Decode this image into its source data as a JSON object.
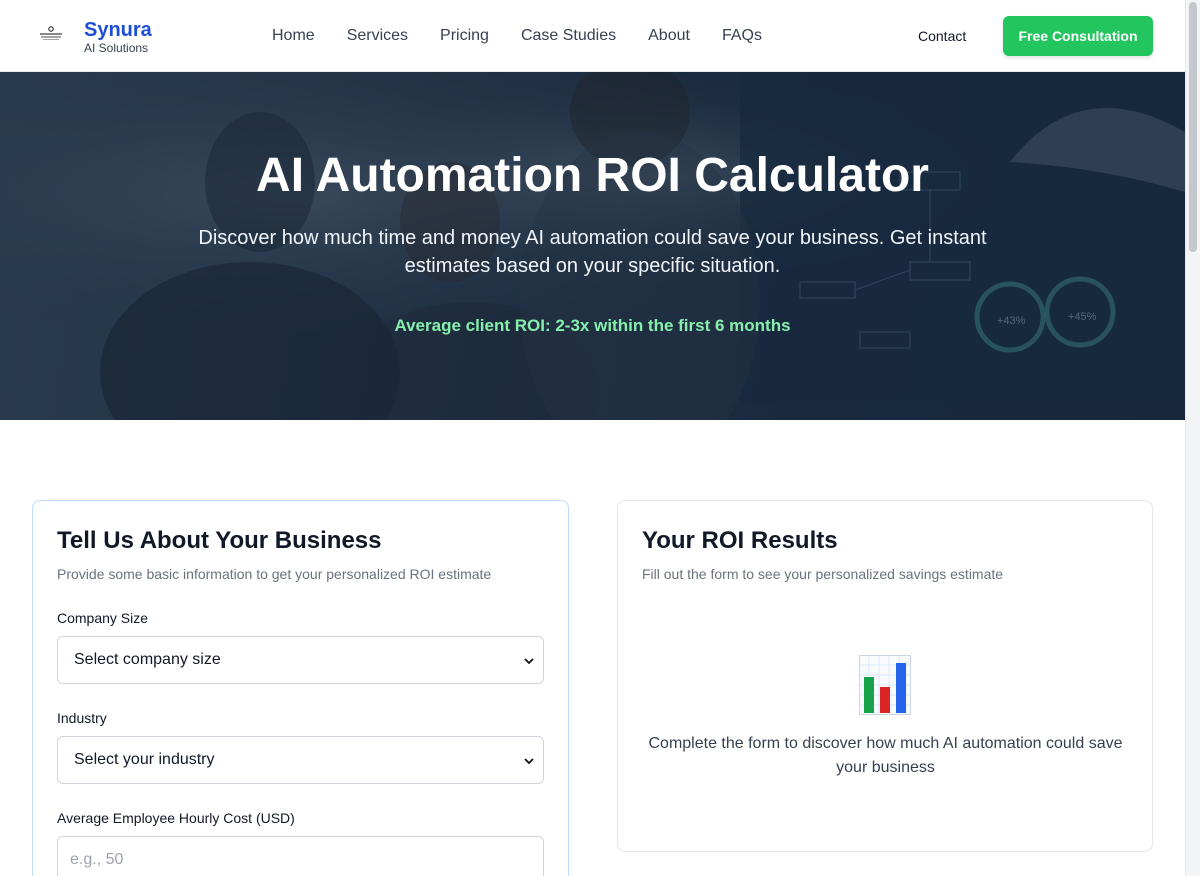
{
  "brand": {
    "name": "Synura",
    "tagline": "AI Solutions"
  },
  "nav": {
    "items": [
      "Home",
      "Services",
      "Pricing",
      "Case Studies",
      "About",
      "FAQs"
    ]
  },
  "header": {
    "contact_label": "Contact",
    "cta_label": "Free Consultation"
  },
  "hero": {
    "title": "AI Automation ROI Calculator",
    "description": "Discover how much time and money AI automation could save your business. Get instant estimates based on your specific situation.",
    "roi_note": "Average client ROI: 2-3x within the first 6 months"
  },
  "form": {
    "title": "Tell Us About Your Business",
    "subtitle": "Provide some basic information to get your personalized ROI estimate",
    "company_size_label": "Company Size",
    "company_size_value": "Select company size",
    "industry_label": "Industry",
    "industry_value": "Select your industry",
    "hourly_cost_label": "Average Employee Hourly Cost (USD)",
    "hourly_cost_placeholder": "e.g., 50"
  },
  "results": {
    "title": "Your ROI Results",
    "subtitle": "Fill out the form to see your personalized savings estimate",
    "icon": "bar-chart-icon",
    "empty_message": "Complete the form to discover how much AI automation could save your business"
  },
  "colors": {
    "brand_blue": "#1d4ed8",
    "cta_green": "#22c55e",
    "roi_green": "#86efac"
  }
}
